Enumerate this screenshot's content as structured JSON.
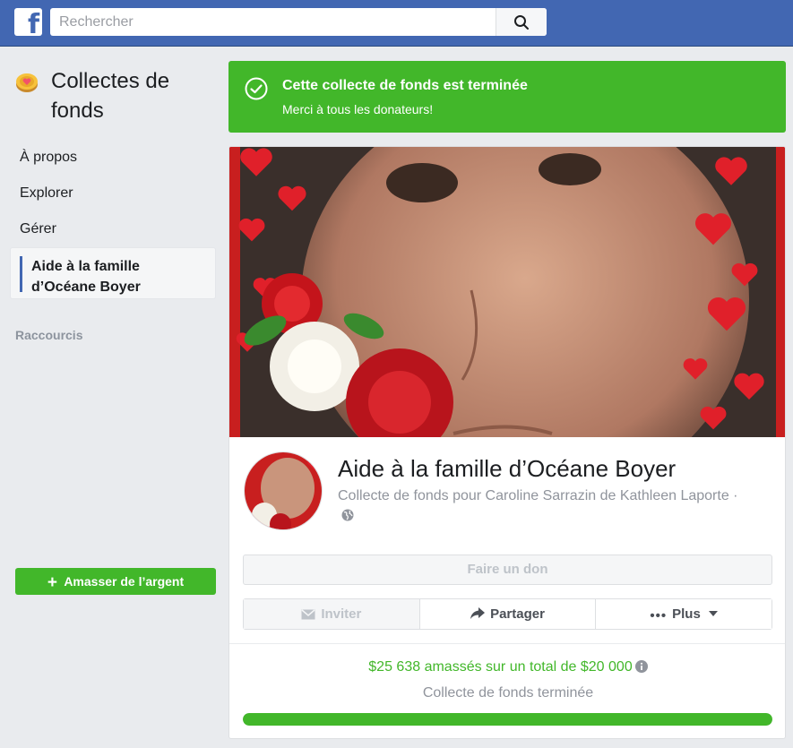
{
  "topbar": {
    "logo_icon": "facebook-logo-icon",
    "search_placeholder": "Rechercher",
    "search_icon": "magnifier-icon"
  },
  "sidebar": {
    "title": "Collectes de fonds",
    "title_icon": "fundraiser-coin-heart-icon",
    "items": [
      {
        "label": "À propos"
      },
      {
        "label": "Explorer"
      },
      {
        "label": "Gérer"
      }
    ],
    "active_item": "Aide à la famille d’Océane Boyer",
    "section_label": "Raccourcis",
    "raise_button": "Amasser de l’argent"
  },
  "banner": {
    "title": "Cette collecte de fonds est terminée",
    "subtitle": "Merci à tous les donateurs!",
    "icon": "check-circle-icon"
  },
  "fundraiser": {
    "title": "Aide à la famille d’Océane Boyer",
    "subtitle": "Collecte de fonds pour Caroline Sarrazin de Kathleen Laporte ·",
    "privacy_icon": "globe-icon",
    "donate_label": "Faire un don",
    "invite_label": "Inviter",
    "share_label": "Partager",
    "more_label": "Plus",
    "raised_text": "$25 638 amassés sur un total de $20 000",
    "status_text": "Collecte de fonds terminée",
    "progress_fraction": 1.0
  },
  "colors": {
    "brand": "#4267b2",
    "success": "#42b72a",
    "muted": "#90949c"
  }
}
